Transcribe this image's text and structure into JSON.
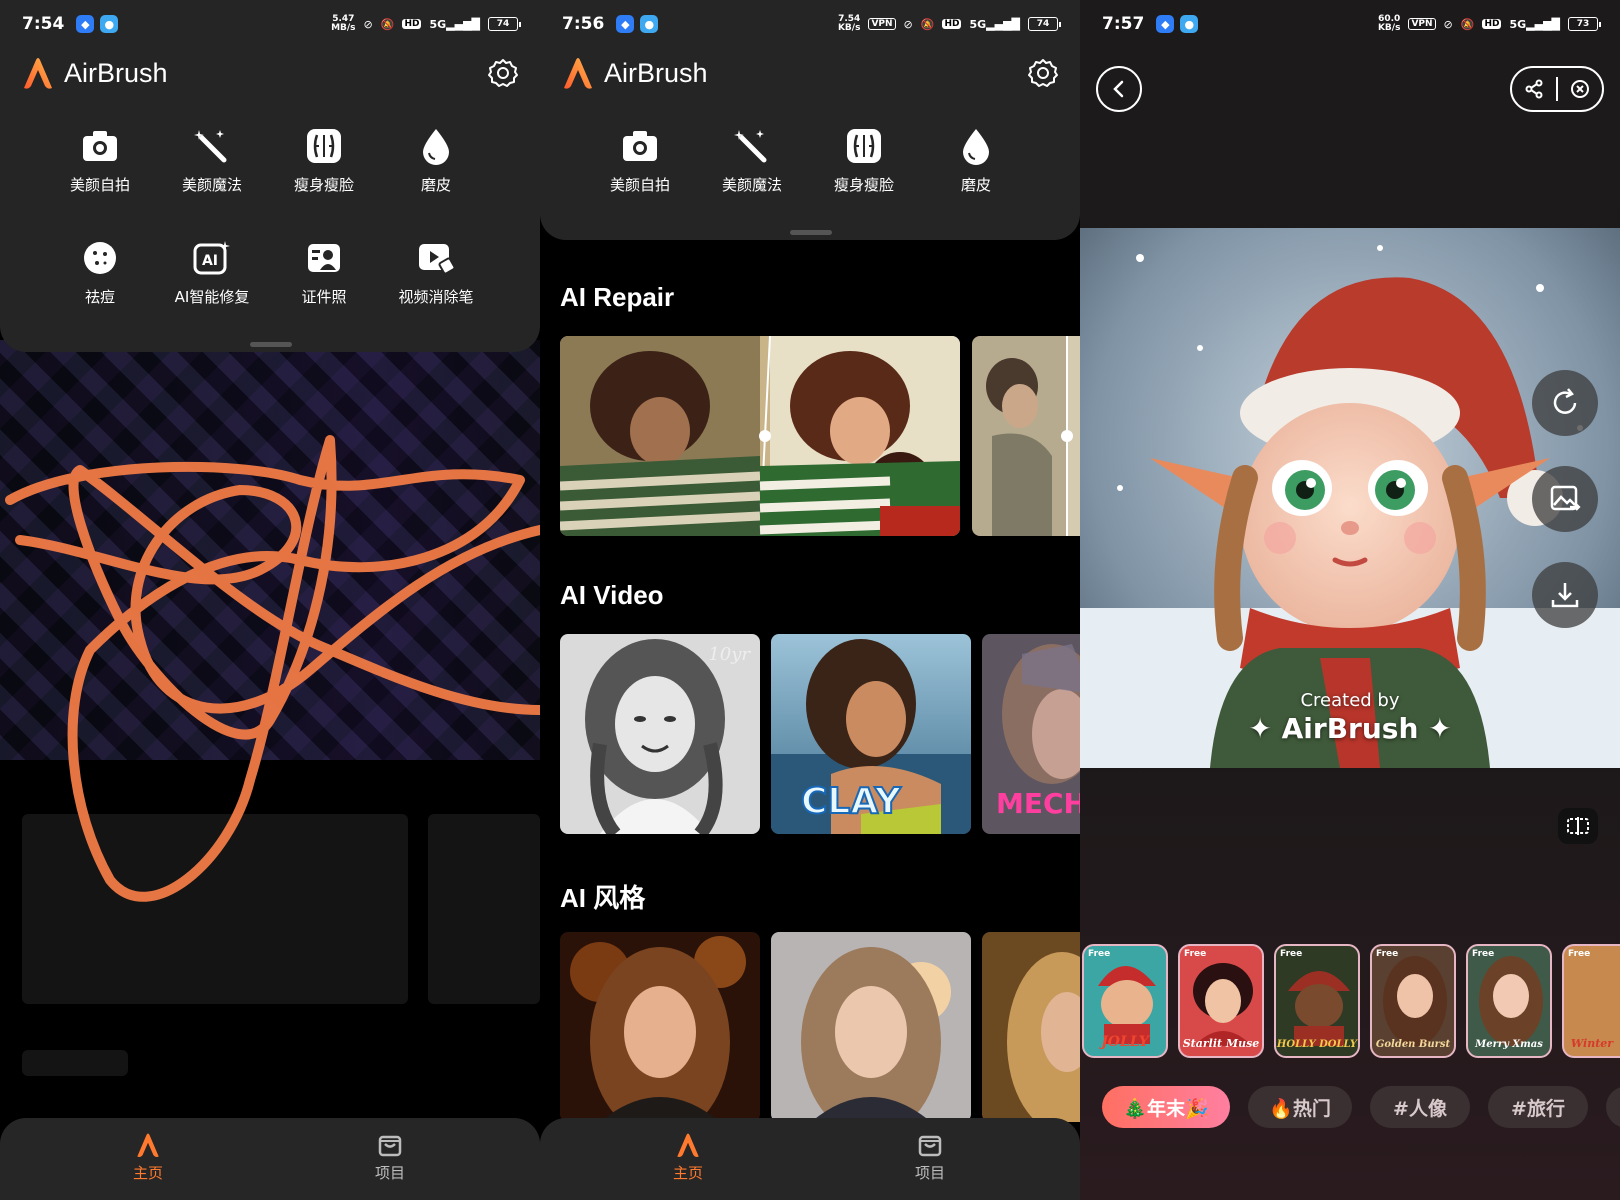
{
  "screens": [
    {
      "status": {
        "time": "7:54",
        "speed": "5.47\nMB/s",
        "battery": "74"
      },
      "app_name": "AirBrush",
      "tools": [
        "美颜自拍",
        "美颜魔法",
        "瘦身瘦脸",
        "磨皮",
        "祛痘",
        "AI智能修复",
        "证件照",
        "视频消除笔"
      ],
      "nav": {
        "home": "主页",
        "projects": "项目"
      }
    },
    {
      "status": {
        "time": "7:56",
        "speed": "7.54\nKB/s",
        "battery": "74",
        "vpn": "VPN"
      },
      "app_name": "AirBrush",
      "tools": [
        "美颜自拍",
        "美颜魔法",
        "瘦身瘦脸",
        "磨皮"
      ],
      "sections": {
        "repair": "AI Repair",
        "video": "AI Video",
        "style": "AI 风格"
      },
      "video_labels": {
        "clay": "CLAY",
        "mech": "MECH",
        "age": "10yr"
      },
      "nav": {
        "home": "主页",
        "projects": "项目"
      }
    },
    {
      "status": {
        "time": "7:57",
        "speed": "60.0\nKB/s",
        "battery": "73",
        "vpn": "VPN"
      },
      "watermark": {
        "line1": "Created by",
        "line2": "✦ AirBrush ✦"
      },
      "styles": [
        {
          "free": "Free",
          "name": "JOLLY"
        },
        {
          "free": "Free",
          "name": "Starlit Muse"
        },
        {
          "free": "Free",
          "name": "HOLLY DOLLY"
        },
        {
          "free": "Free",
          "name": "Golden Burst"
        },
        {
          "free": "Free",
          "name": "Merry Xmas"
        },
        {
          "free": "Free",
          "name": "Winter"
        }
      ],
      "chips": [
        "🎄年末🎉",
        "🔥热门",
        "#人像",
        "#旅行"
      ]
    }
  ],
  "colors": {
    "accent": "#ff7a2e",
    "card": "#252525",
    "scribble": "#f07a45"
  }
}
